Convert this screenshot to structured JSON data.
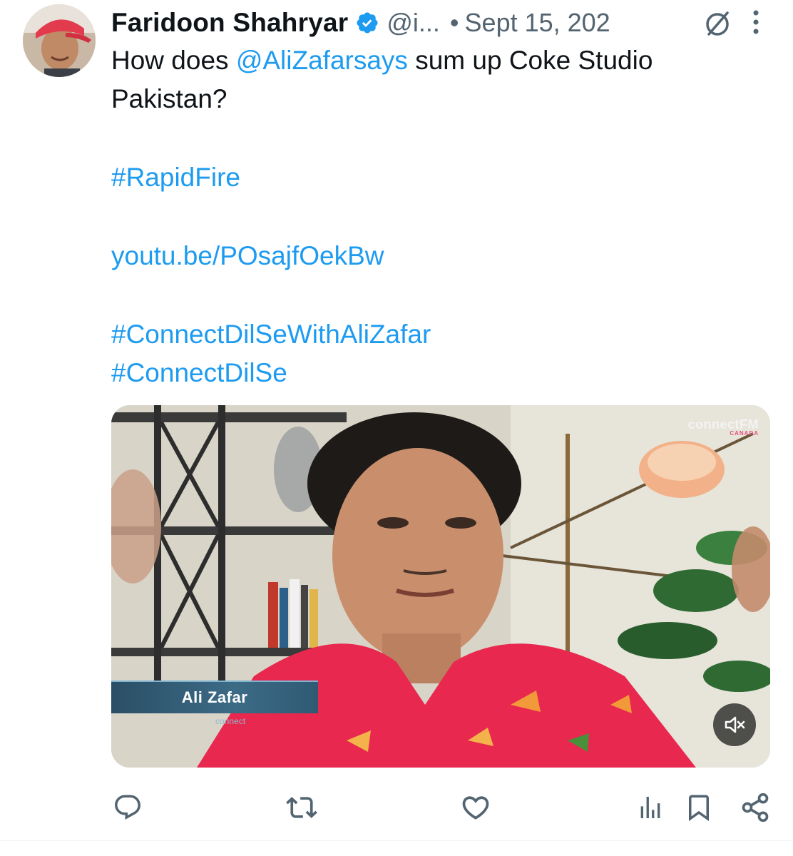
{
  "author": {
    "display_name": "Faridoon Shahryar",
    "handle": "@i...",
    "separator": "•",
    "timestamp": "Sept 15, 202",
    "verified": true
  },
  "tweet": {
    "text_line1_prefix": "How does ",
    "mention": "@AliZafarsays",
    "text_line1_suffix": " sum up Coke Studio",
    "text_line2": "Pakistan?",
    "hashtag_rapidfire": "#RapidFire",
    "link": "youtu.be/POsajfOekBw",
    "hashtag_connect_1": "#ConnectDilSeWithAliZafar",
    "hashtag_connect_2": "#ConnectDilSe"
  },
  "media": {
    "type": "video",
    "lower_third_name": "Ali Zafar",
    "lower_third_brand": "connect",
    "watermark_main": "connectFM",
    "watermark_sub": "CANADA",
    "muted": true
  },
  "actions": {
    "icons": [
      "reply-icon",
      "repost-icon",
      "like-icon",
      "views-icon",
      "bookmark-icon",
      "share-icon"
    ]
  },
  "colors": {
    "link": "#1d9bf0",
    "text": "#0f1419",
    "secondary": "#536471",
    "verified_badge": "#1d9bf0"
  }
}
